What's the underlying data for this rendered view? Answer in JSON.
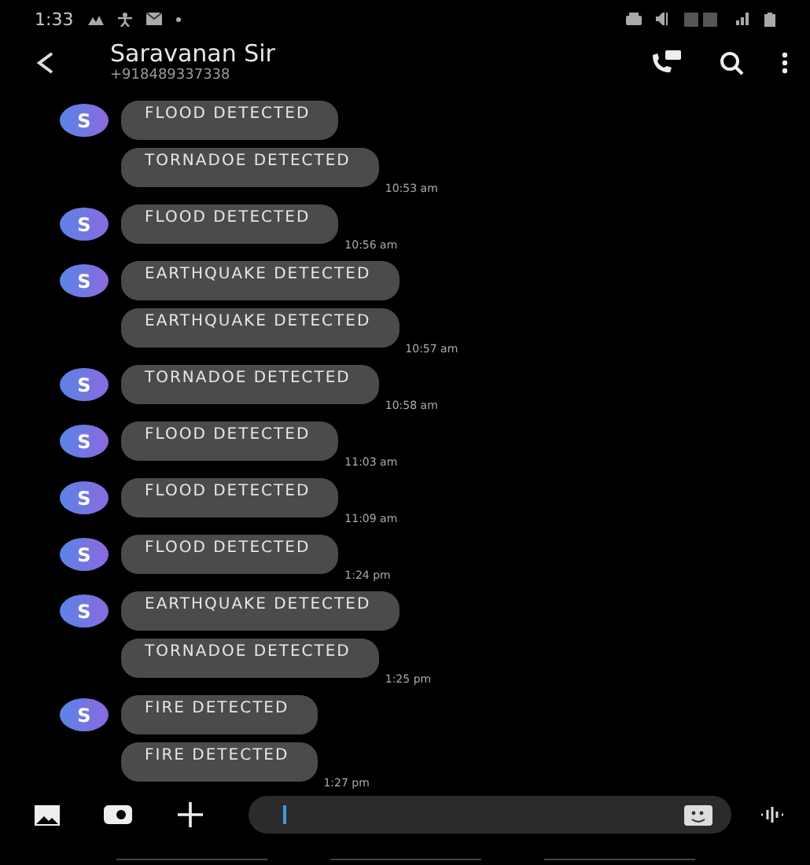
{
  "status_bar": {
    "time": "1:33"
  },
  "header": {
    "name": "Saravanan Sir",
    "number": "+918489337338"
  },
  "groups": [
    {
      "avatar": "S",
      "messages": [
        "FLOOD DETECTED",
        "TORNADOE DETECTED"
      ],
      "time": "10:53 am"
    },
    {
      "avatar": "S",
      "messages": [
        "FLOOD DETECTED"
      ],
      "time": "10:56 am"
    },
    {
      "avatar": "S",
      "messages": [
        "EARTHQUAKE  DETECTED",
        "EARTHQUAKE  DETECTED"
      ],
      "time": "10:57 am"
    },
    {
      "avatar": "S",
      "messages": [
        "TORNADOE DETECTED"
      ],
      "time": "10:58 am"
    },
    {
      "avatar": "S",
      "messages": [
        "FLOOD DETECTED"
      ],
      "time": "11:03 am"
    },
    {
      "avatar": "S",
      "messages": [
        "FLOOD DETECTED"
      ],
      "time": "11:09 am"
    },
    {
      "avatar": "S",
      "messages": [
        "FLOOD DETECTED"
      ],
      "time": "1:24 pm"
    },
    {
      "avatar": "S",
      "messages": [
        "EARTHQUAKE  DETECTED",
        "TORNADOE DETECTED"
      ],
      "time": "1:25 pm"
    },
    {
      "avatar": "S",
      "messages": [
        "FIRE DETECTED",
        "FIRE DETECTED"
      ],
      "time": "1:27 pm"
    }
  ],
  "composer": {
    "focused": true
  }
}
